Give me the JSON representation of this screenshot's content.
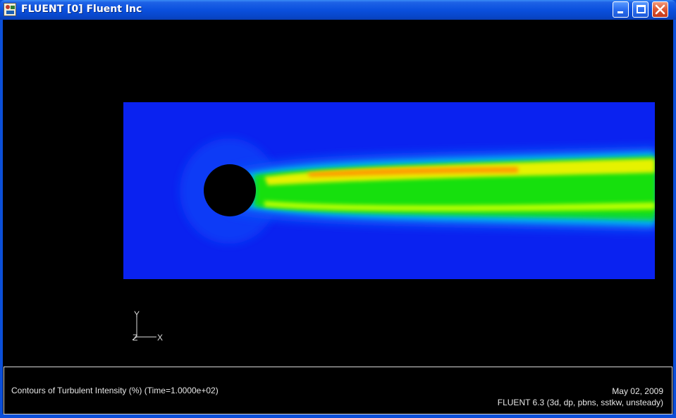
{
  "window": {
    "title": "FLUENT [0] Fluent Inc",
    "icon": "fluent-app-icon",
    "controls": {
      "minimize": "minimize-icon",
      "maximize": "maximize-icon",
      "close": "close-icon"
    }
  },
  "colors": {
    "titlebar": "#0a50de",
    "background": "#000000",
    "contour_low": "#0a22f0",
    "contour_mid": "#00e000",
    "contour_high": "#ff9a00"
  },
  "axes_triad": {
    "y_label": "Y",
    "x_label": "X",
    "z_label": "Z"
  },
  "caption": {
    "left": "Contours of Turbulent Intensity (%)  (Time=1.0000e+02)",
    "date": "May 02, 2009",
    "solver": "FLUENT 6.3 (3d, dp, pbns, sstkw, unsteady)"
  }
}
